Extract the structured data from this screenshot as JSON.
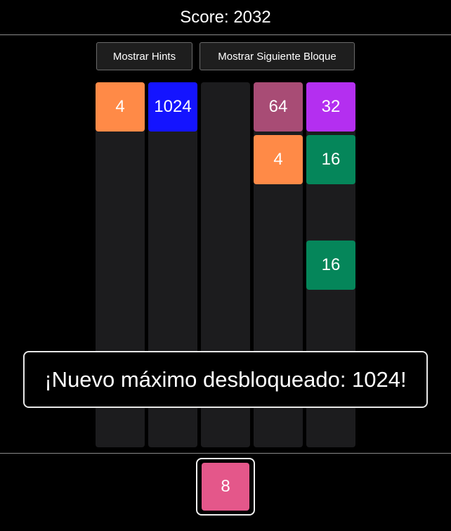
{
  "header": {
    "score_text": "Score: 2032"
  },
  "buttons": {
    "hints_label": "Mostrar Hints",
    "next_block_label": "Mostrar Siguiente Bloque"
  },
  "board": {
    "columns": [
      {
        "tiles": [
          "4"
        ]
      },
      {
        "tiles": [
          "1024"
        ]
      },
      {
        "tiles": []
      },
      {
        "tiles": [
          "64",
          "4"
        ]
      },
      {
        "tiles": [
          "32",
          "16",
          "",
          "16"
        ]
      }
    ]
  },
  "toast": {
    "message": "¡Nuevo máximo desbloqueado: 1024!"
  },
  "next_block": {
    "value": "8"
  },
  "colors": {
    "tile_4": "#ff8a47",
    "tile_8": "#e4578a",
    "tile_16": "#05865a",
    "tile_32": "#b42ff0",
    "tile_64": "#a84c75",
    "tile_1024": "#1414ff",
    "column_bg": "#1c1c1e",
    "background": "#000000"
  }
}
